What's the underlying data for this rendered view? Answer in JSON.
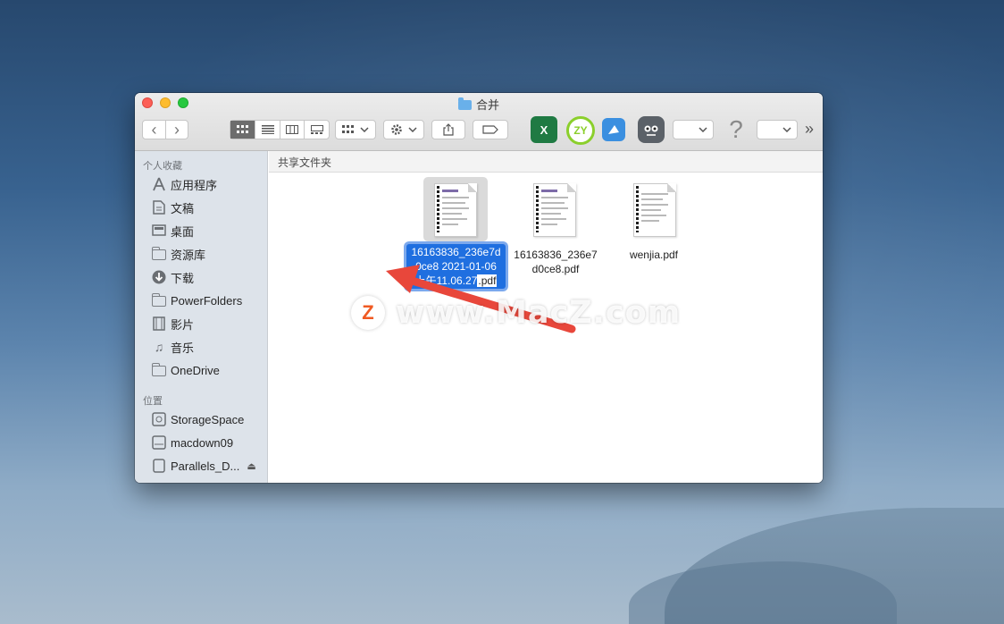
{
  "window": {
    "title": "合并"
  },
  "toolbar": {
    "back": "‹",
    "forward": "›",
    "view_modes": [
      "icon-view",
      "list-view",
      "column-view",
      "gallery-view"
    ],
    "overflow": "»",
    "app_icons": [
      "excel-icon",
      "zy-icon",
      "paw-icon",
      "robot-icon",
      "help-icon"
    ]
  },
  "sidebar": {
    "favorites_heading": "个人收藏",
    "favorites": [
      {
        "label": "应用程序",
        "icon": "applications-icon"
      },
      {
        "label": "文稿",
        "icon": "documents-icon"
      },
      {
        "label": "桌面",
        "icon": "desktop-icon"
      },
      {
        "label": "资源库",
        "icon": "folder-icon"
      },
      {
        "label": "下载",
        "icon": "downloads-icon"
      },
      {
        "label": "PowerFolders",
        "icon": "folder-icon"
      },
      {
        "label": "影片",
        "icon": "movies-icon"
      },
      {
        "label": "音乐",
        "icon": "music-icon"
      },
      {
        "label": "OneDrive",
        "icon": "folder-icon"
      }
    ],
    "locations_heading": "位置",
    "locations": [
      {
        "label": "StorageSpace",
        "icon": "disk-icon"
      },
      {
        "label": "macdown09",
        "icon": "disk-icon"
      },
      {
        "label": "Parallels_D...",
        "icon": "disk-icon"
      }
    ]
  },
  "pathbar": {
    "label": "共享文件夹"
  },
  "files": [
    {
      "line1": "16163836_236e7d",
      "line2": "0ce8 2021-01-06",
      "line3_main": "上午11.06.27",
      "line3_tail": ".pdf",
      "selected": true
    },
    {
      "line1": "16163836_236e7",
      "line2": "d0ce8.pdf",
      "selected": false
    },
    {
      "line1": "wenjia.pdf",
      "selected": false
    }
  ],
  "watermark": {
    "logo": "Z",
    "text": "www.MacZ.com"
  },
  "colors": {
    "selection": "#1f6fe0",
    "arrow": "#e8473b",
    "sidebar": "#dde3ea"
  }
}
